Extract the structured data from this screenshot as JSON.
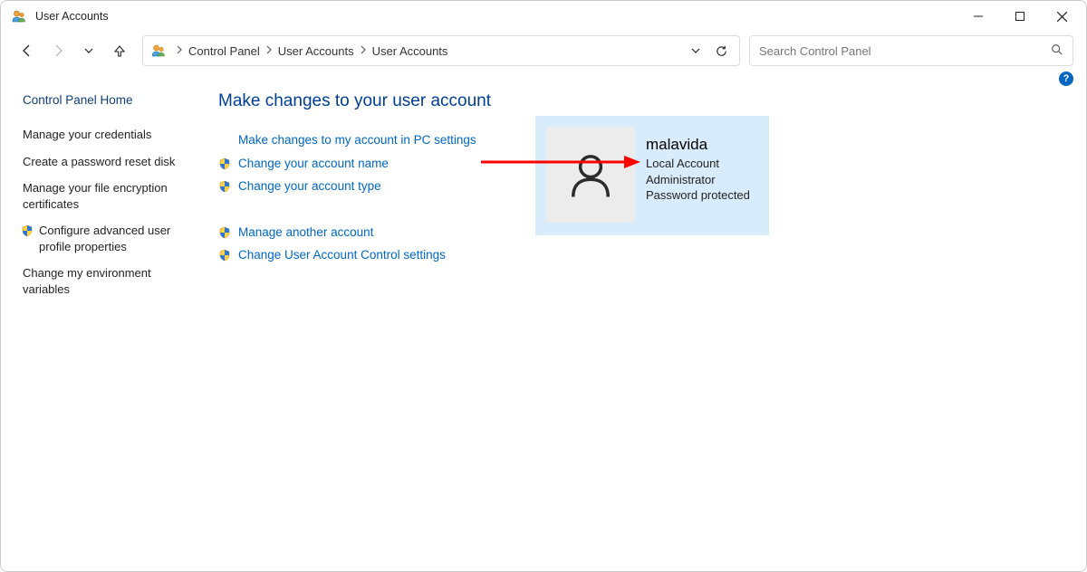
{
  "window": {
    "title": "User Accounts"
  },
  "breadcrumbs": {
    "0": "Control Panel",
    "1": "User Accounts",
    "2": "User Accounts"
  },
  "search": {
    "placeholder": "Search Control Panel"
  },
  "sidebar": {
    "home": "Control Panel Home",
    "items": {
      "0": "Manage your credentials",
      "1": "Create a password reset disk",
      "2": "Manage your file encryption certificates",
      "3": "Configure advanced user profile properties",
      "4": "Change my environment variables"
    }
  },
  "main": {
    "heading": "Make changes to your user account",
    "links": {
      "pc_settings": "Make changes to my account in PC settings",
      "change_name": "Change your account name",
      "change_type": "Change your account type",
      "manage_another": "Manage another account",
      "uac_settings": "Change User Account Control settings"
    }
  },
  "user": {
    "name": "malavida",
    "type": "Local Account",
    "role": "Administrator",
    "protected": "Password protected"
  }
}
